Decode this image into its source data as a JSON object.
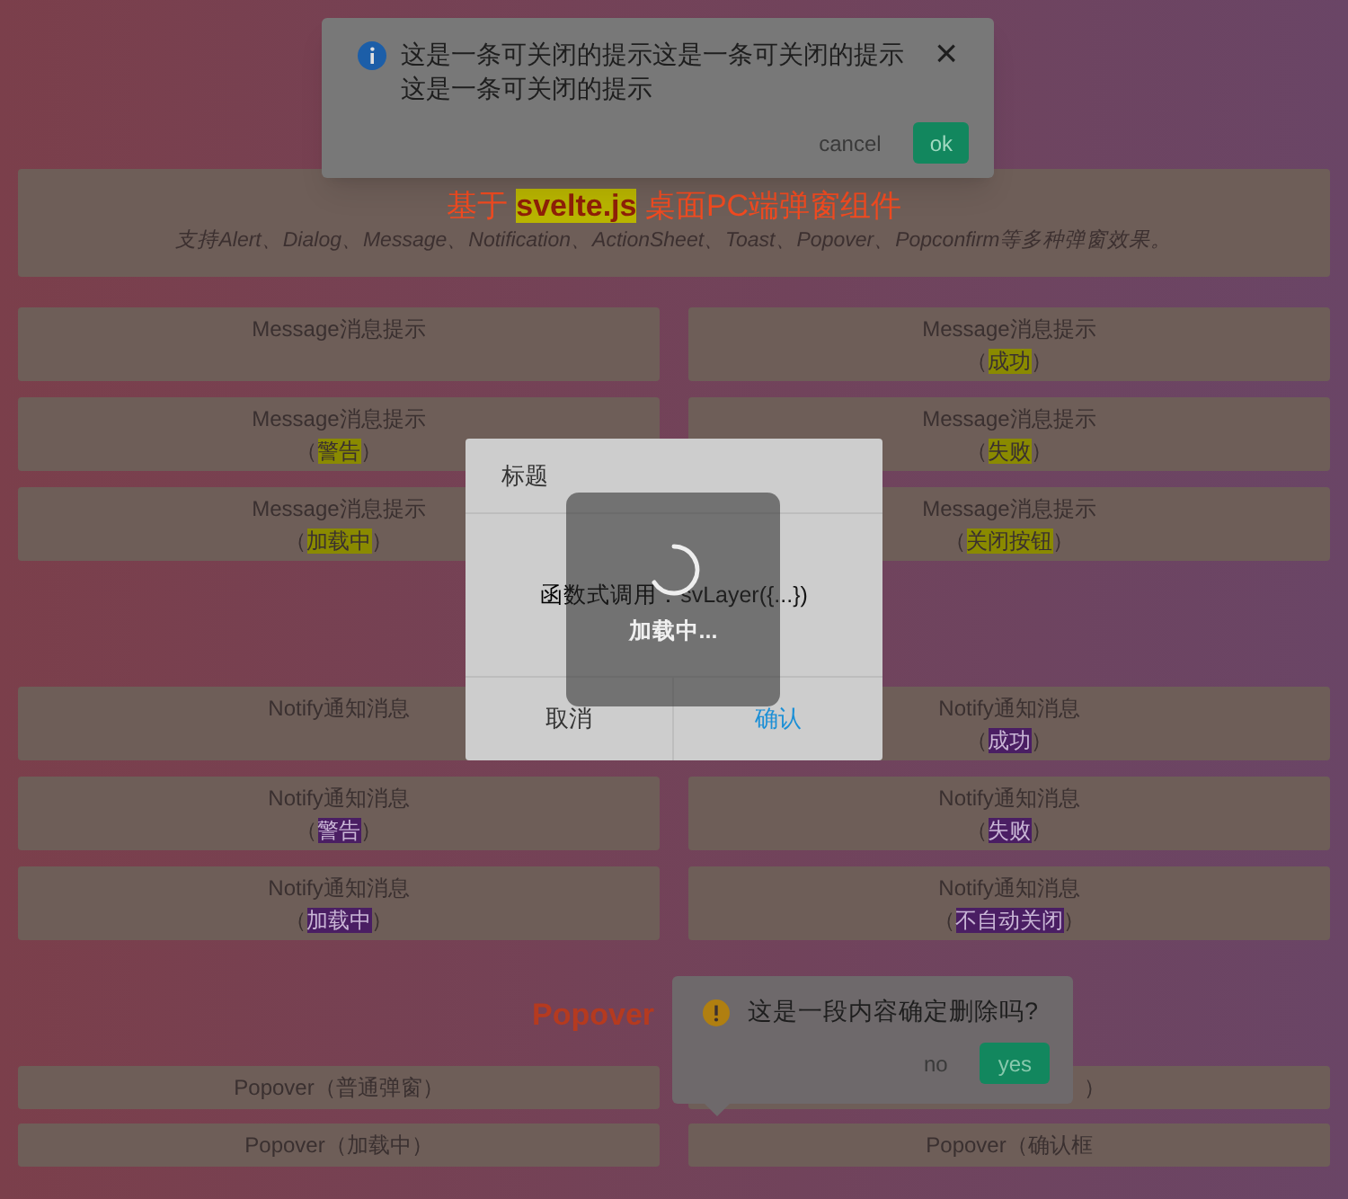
{
  "header": {
    "title_before": "基于",
    "title_highlight": "svelte.js",
    "title_after": "桌面PC端弹窗组件",
    "subtitle": "支持Alert、Dialog、Message、Notification、ActionSheet、Toast、Popover、Popconfirm等多种弹窗效果。"
  },
  "sections": [
    {
      "kind": "message",
      "buttons": [
        {
          "label": "Message消息提示"
        },
        {
          "label": "Message消息提示",
          "tag": [
            "（",
            "成功",
            "）"
          ]
        },
        {
          "label": "Message消息提示",
          "tag": [
            "（",
            "警告",
            "）"
          ]
        },
        {
          "label": "Message消息提示",
          "tag": [
            "（",
            "失败",
            "）"
          ]
        },
        {
          "label": "Message消息提示",
          "tag": [
            "（",
            "加载中",
            "）"
          ]
        },
        {
          "label": "Message消息提示",
          "tag": [
            "（",
            "关闭按钮",
            "）"
          ]
        }
      ]
    },
    {
      "kind": "notify",
      "buttons": [
        {
          "label": "Notify通知消息"
        },
        {
          "label": "Notify通知消息",
          "tag": [
            "（",
            "成功",
            "）"
          ]
        },
        {
          "label": "Notify通知消息",
          "tag": [
            "（",
            "警告",
            "）"
          ]
        },
        {
          "label": "Notify通知消息",
          "tag": [
            "（",
            "失败",
            "）"
          ]
        },
        {
          "label": "Notify通知消息",
          "tag": [
            "（",
            "加载中",
            "）"
          ]
        },
        {
          "label": "Notify通知消息",
          "tag": [
            "（",
            "不自动关闭",
            "）"
          ]
        }
      ]
    },
    {
      "kind": "popover",
      "title": "Popover",
      "buttons": [
        {
          "label": "Popover（普通弹窗）"
        },
        {
          "label": "）",
          "kind": "partial"
        },
        {
          "label": "Popover（加载中）"
        },
        {
          "label": "Popover（确认框"
        }
      ]
    }
  ],
  "notification": {
    "message": "这是一条可关闭的提示这是一条可关闭的提示这是一条可关闭的提示",
    "close": "×",
    "buttons": [
      {
        "label": "cancel",
        "kind": "plain"
      },
      {
        "label": "ok",
        "kind": "primary"
      }
    ]
  },
  "dialog": {
    "title": "标题",
    "label": "函数式调用：",
    "code": "svLayer({...})",
    "buttons": [
      {
        "label": "取消",
        "kind": "plain"
      },
      {
        "label": "确认",
        "kind": "primary"
      }
    ]
  },
  "toast": {
    "text": "加载中..."
  },
  "popconfirm": {
    "message": "这是一段内容确定删除吗?",
    "buttons": [
      {
        "label": "no",
        "kind": "plain"
      },
      {
        "label": "yes",
        "kind": "primary"
      }
    ]
  }
}
